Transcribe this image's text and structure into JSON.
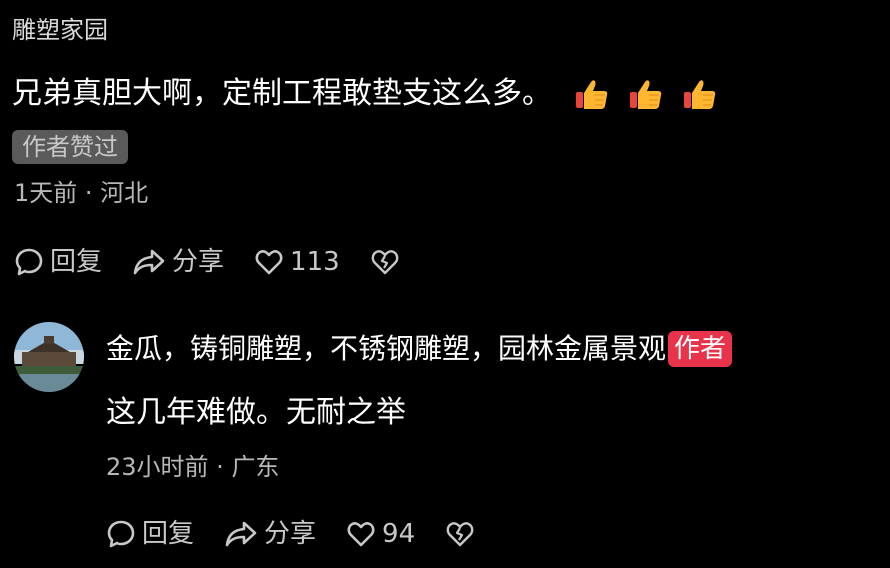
{
  "top_comment": {
    "username": "雕塑家园",
    "text": "兄弟真胆大啊，定制工程敢垫支这么多。",
    "emojis": [
      "thumbs-up-icon",
      "thumbs-up-icon",
      "thumbs-up-icon"
    ],
    "author_liked_label": "作者赞过",
    "time": "1天前",
    "separator": " · ",
    "location": "河北",
    "actions": {
      "reply_label": "回复",
      "share_label": "分享",
      "like_count": "113"
    }
  },
  "reply": {
    "username": "金瓜，铸铜雕塑，不锈钢雕塑，园林金属景观",
    "author_badge": "作者",
    "text": "这几年难做。无耐之举",
    "time": "23小时前",
    "separator": " · ",
    "location": "广东",
    "actions": {
      "reply_label": "回复",
      "share_label": "分享",
      "like_count": "94"
    }
  },
  "colors": {
    "background": "#000000",
    "badge": "#e8334a",
    "muted_text": "#b8b8b8",
    "tag_bg": "#5a5a5a"
  }
}
